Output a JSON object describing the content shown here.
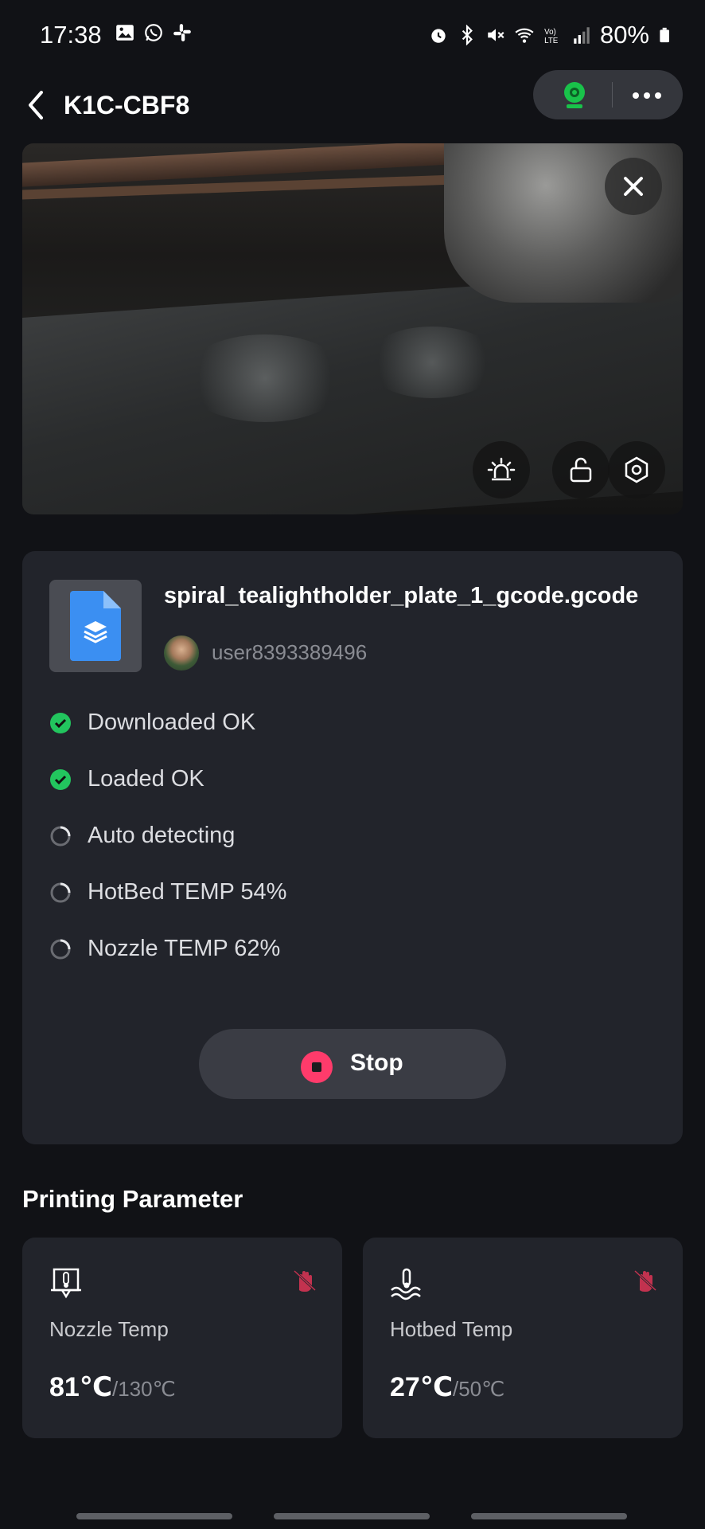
{
  "status_bar": {
    "time": "17:38",
    "battery": "80%",
    "left_icons": [
      "gallery-icon",
      "whatsapp-icon",
      "slack-icon"
    ],
    "right_icons": [
      "alarm-icon",
      "bluetooth-icon",
      "mute-icon",
      "wifi-icon",
      "volte-icon",
      "signal-icon",
      "battery-icon"
    ]
  },
  "header": {
    "title": "K1C-CBF8",
    "webcam_color": "#19c24a"
  },
  "file": {
    "name": "spiral_tealightholder_plate_1_gcode.gcode",
    "user": "user8393389496"
  },
  "steps": [
    {
      "label": "Downloaded OK",
      "state": "done"
    },
    {
      "label": "Loaded OK",
      "state": "done"
    },
    {
      "label": "Auto detecting",
      "state": "pending"
    },
    {
      "label": "HotBed TEMP 54%",
      "state": "pending"
    },
    {
      "label": "Nozzle TEMP 62%",
      "state": "pending"
    }
  ],
  "stop_button": {
    "label": "Stop",
    "color": "#ff3b6b"
  },
  "section_title": "Printing Parameter",
  "params": [
    {
      "label": "Nozzle Temp",
      "value": "81℃",
      "max": "/130℃"
    },
    {
      "label": "Hotbed Temp",
      "value": "27℃",
      "max": "/50℃"
    }
  ],
  "colors": {
    "success": "#22c55e",
    "accent_red": "#c2324f",
    "card_bg": "#22242b",
    "bg": "#111216"
  }
}
